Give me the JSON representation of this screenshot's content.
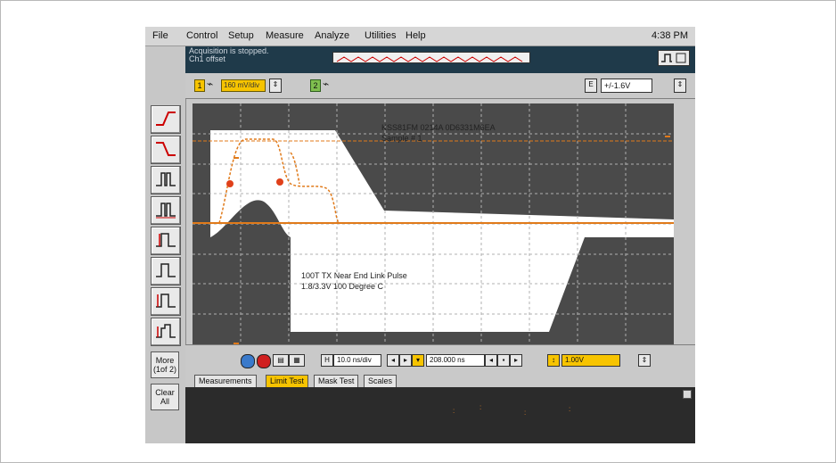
{
  "menu": {
    "items": [
      "File",
      "Control",
      "Setup",
      "Measure",
      "Analyze",
      "Utilities",
      "Help"
    ],
    "clock": "4:38 PM"
  },
  "status": {
    "line1": "Acquisition is stopped.",
    "line2": "Ch1 offset"
  },
  "channels": {
    "ch1_label": "1",
    "ch1_scale": "160 mV/div",
    "ch2_label": "2"
  },
  "trigger": {
    "level": "+/-1.6V"
  },
  "screen": {
    "title_line1": "KSS81FM 0214A 0D6331M6EA",
    "title_line2": "Sample # 1",
    "mask_line1": "100T TX Near End Link Pulse",
    "mask_line2": "1.8/3.3V 100 Degree C"
  },
  "bottom": {
    "timebase": "10.0 ns/div",
    "delay": "208.000 ns",
    "offset": "1.00V"
  },
  "left_buttons": {
    "more": "More (1of 2)",
    "clear": "Clear All"
  },
  "tabs": [
    "Measurements",
    "Limit Test",
    "Mask Test",
    "Scales"
  ],
  "colors": {
    "trace": "#e07a1a",
    "mask": "#ffffff",
    "screen_bg": "#4a4a4a",
    "accent": "#f7c400"
  }
}
